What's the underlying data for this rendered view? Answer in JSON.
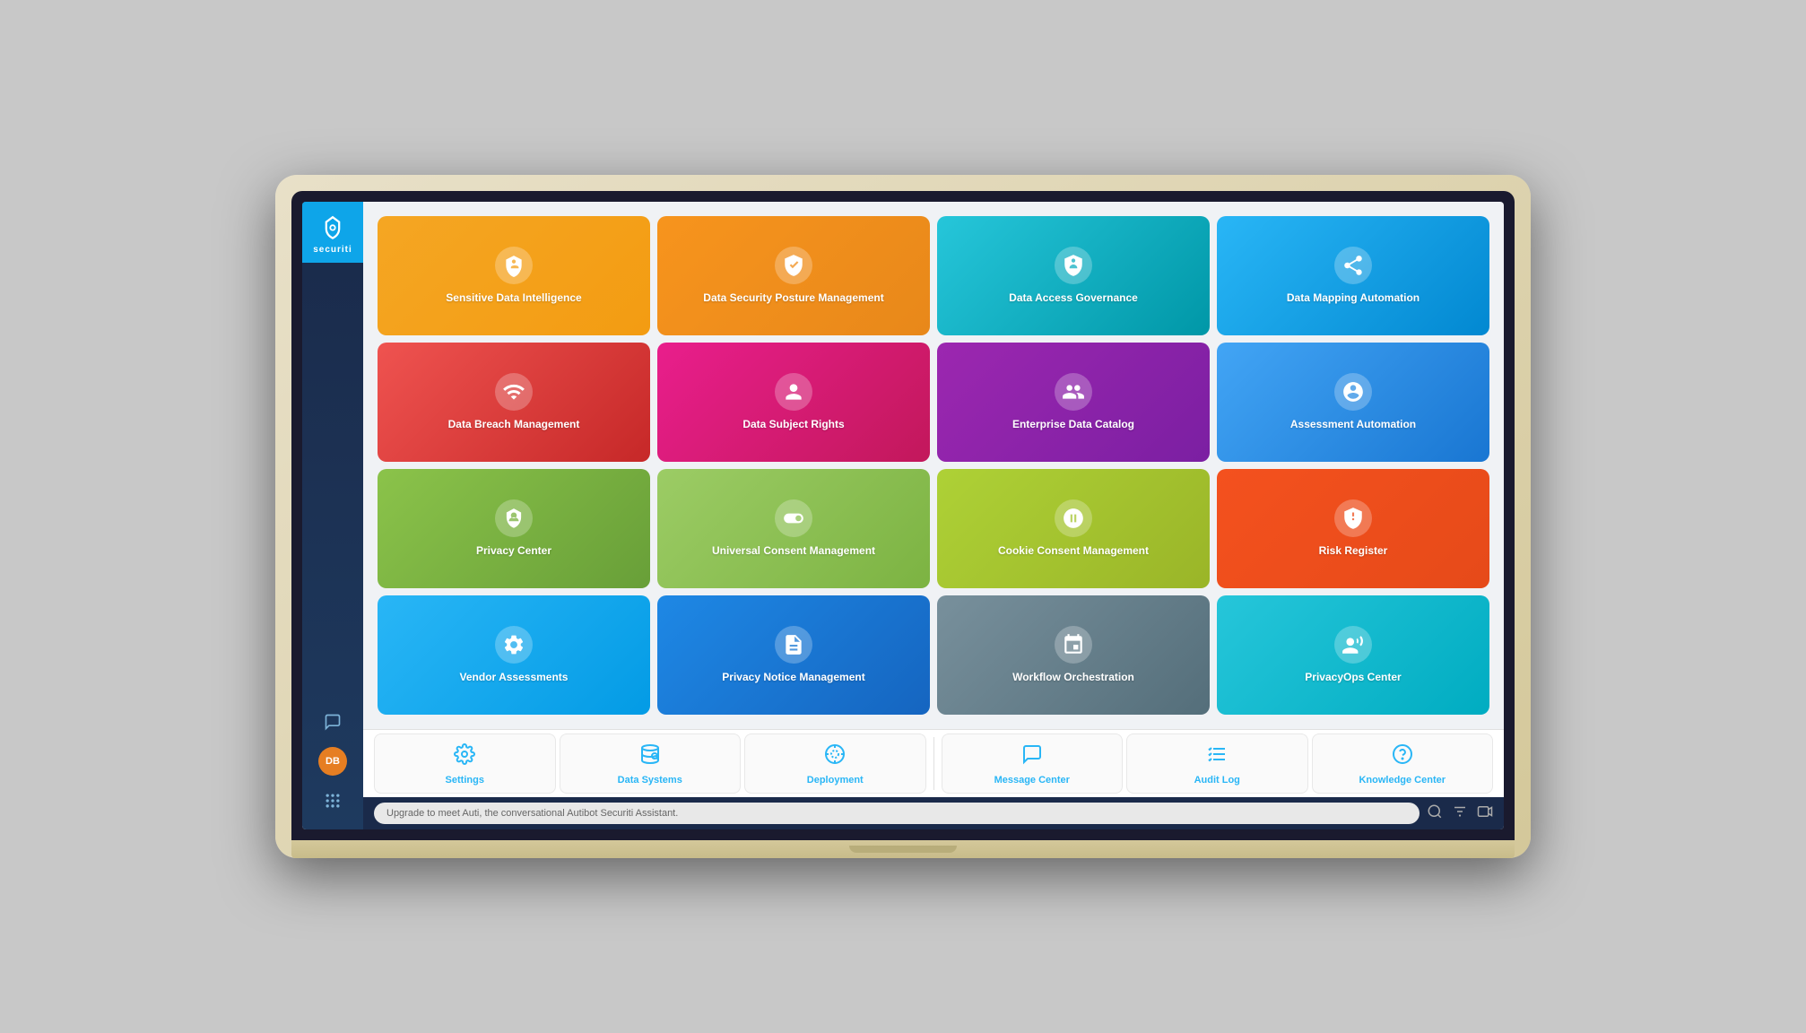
{
  "app": {
    "name": "securiti",
    "logo_text": "securiti"
  },
  "sidebar": {
    "avatar_initials": "DB",
    "icons": [
      "chat",
      "avatar",
      "grid"
    ]
  },
  "tiles": [
    {
      "id": "sensitive-data-intelligence",
      "label": "Sensitive Data Intelligence",
      "color": "orange",
      "icon": "shield-search"
    },
    {
      "id": "data-security-posture",
      "label": "Data Security Posture Management",
      "color": "orange2",
      "icon": "shield-check"
    },
    {
      "id": "data-access-governance",
      "label": "Data Access Governance",
      "color": "teal",
      "icon": "shield-lock"
    },
    {
      "id": "data-mapping-automation",
      "label": "Data Mapping Automation",
      "color": "cyan",
      "icon": "share"
    },
    {
      "id": "data-breach-management",
      "label": "Data Breach Management",
      "color": "red",
      "icon": "wifi-alert"
    },
    {
      "id": "data-subject-rights",
      "label": "Data Subject Rights",
      "color": "pink",
      "icon": "person-circle"
    },
    {
      "id": "enterprise-data-catalog",
      "label": "Enterprise Data Catalog",
      "color": "purple",
      "icon": "people"
    },
    {
      "id": "assessment-automation",
      "label": "Assessment Automation",
      "color": "blue-light",
      "icon": "target"
    },
    {
      "id": "privacy-center",
      "label": "Privacy Center",
      "color": "green",
      "icon": "hexagon"
    },
    {
      "id": "universal-consent",
      "label": "Universal Consent Management",
      "color": "lime",
      "icon": "toggle"
    },
    {
      "id": "cookie-consent",
      "label": "Cookie Consent Management",
      "color": "lime2",
      "icon": "cookie"
    },
    {
      "id": "risk-register",
      "label": "Risk Register",
      "color": "orange-red",
      "icon": "warning-shield"
    },
    {
      "id": "vendor-assessments",
      "label": "Vendor Assessments",
      "color": "sky",
      "icon": "settings-circle"
    },
    {
      "id": "privacy-notice",
      "label": "Privacy Notice Management",
      "color": "blue2",
      "icon": "document"
    },
    {
      "id": "workflow-orchestration",
      "label": "Workflow Orchestration",
      "color": "gray",
      "icon": "flow"
    },
    {
      "id": "privacyops-center",
      "label": "PrivacyOps Center",
      "color": "cyan2",
      "icon": "eyes"
    }
  ],
  "bottom_items": [
    {
      "id": "settings",
      "label": "Settings",
      "icon": "gear"
    },
    {
      "id": "data-systems",
      "label": "Data Systems",
      "icon": "database-search"
    },
    {
      "id": "deployment",
      "label": "Deployment",
      "icon": "gear-dotted"
    },
    {
      "id": "message-center",
      "label": "Message Center",
      "icon": "chat-square"
    },
    {
      "id": "audit-log",
      "label": "Audit Log",
      "icon": "list-check"
    },
    {
      "id": "knowledge-center",
      "label": "Knowledge Center",
      "icon": "question-circle"
    }
  ],
  "taskbar": {
    "chat_placeholder": "Upgrade to meet Auti, the conversational Autibot Securiti Assistant."
  }
}
